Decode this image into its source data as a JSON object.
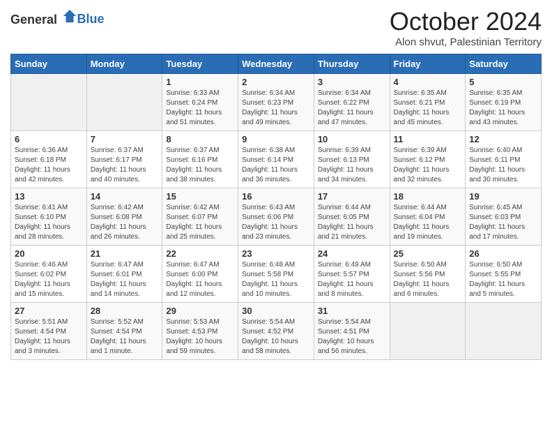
{
  "header": {
    "logo_general": "General",
    "logo_blue": "Blue",
    "month": "October 2024",
    "location": "Alon shvut, Palestinian Territory"
  },
  "days_of_week": [
    "Sunday",
    "Monday",
    "Tuesday",
    "Wednesday",
    "Thursday",
    "Friday",
    "Saturday"
  ],
  "weeks": [
    [
      {
        "day": "",
        "info": ""
      },
      {
        "day": "",
        "info": ""
      },
      {
        "day": "1",
        "info": "Sunrise: 6:33 AM\nSunset: 6:24 PM\nDaylight: 11 hours and 51 minutes."
      },
      {
        "day": "2",
        "info": "Sunrise: 6:34 AM\nSunset: 6:23 PM\nDaylight: 11 hours and 49 minutes."
      },
      {
        "day": "3",
        "info": "Sunrise: 6:34 AM\nSunset: 6:22 PM\nDaylight: 11 hours and 47 minutes."
      },
      {
        "day": "4",
        "info": "Sunrise: 6:35 AM\nSunset: 6:21 PM\nDaylight: 11 hours and 45 minutes."
      },
      {
        "day": "5",
        "info": "Sunrise: 6:35 AM\nSunset: 6:19 PM\nDaylight: 11 hours and 43 minutes."
      }
    ],
    [
      {
        "day": "6",
        "info": "Sunrise: 6:36 AM\nSunset: 6:18 PM\nDaylight: 11 hours and 42 minutes."
      },
      {
        "day": "7",
        "info": "Sunrise: 6:37 AM\nSunset: 6:17 PM\nDaylight: 11 hours and 40 minutes."
      },
      {
        "day": "8",
        "info": "Sunrise: 6:37 AM\nSunset: 6:16 PM\nDaylight: 11 hours and 38 minutes."
      },
      {
        "day": "9",
        "info": "Sunrise: 6:38 AM\nSunset: 6:14 PM\nDaylight: 11 hours and 36 minutes."
      },
      {
        "day": "10",
        "info": "Sunrise: 6:39 AM\nSunset: 6:13 PM\nDaylight: 11 hours and 34 minutes."
      },
      {
        "day": "11",
        "info": "Sunrise: 6:39 AM\nSunset: 6:12 PM\nDaylight: 11 hours and 32 minutes."
      },
      {
        "day": "12",
        "info": "Sunrise: 6:40 AM\nSunset: 6:11 PM\nDaylight: 11 hours and 30 minutes."
      }
    ],
    [
      {
        "day": "13",
        "info": "Sunrise: 6:41 AM\nSunset: 6:10 PM\nDaylight: 11 hours and 28 minutes."
      },
      {
        "day": "14",
        "info": "Sunrise: 6:42 AM\nSunset: 6:08 PM\nDaylight: 11 hours and 26 minutes."
      },
      {
        "day": "15",
        "info": "Sunrise: 6:42 AM\nSunset: 6:07 PM\nDaylight: 11 hours and 25 minutes."
      },
      {
        "day": "16",
        "info": "Sunrise: 6:43 AM\nSunset: 6:06 PM\nDaylight: 11 hours and 23 minutes."
      },
      {
        "day": "17",
        "info": "Sunrise: 6:44 AM\nSunset: 6:05 PM\nDaylight: 11 hours and 21 minutes."
      },
      {
        "day": "18",
        "info": "Sunrise: 6:44 AM\nSunset: 6:04 PM\nDaylight: 11 hours and 19 minutes."
      },
      {
        "day": "19",
        "info": "Sunrise: 6:45 AM\nSunset: 6:03 PM\nDaylight: 11 hours and 17 minutes."
      }
    ],
    [
      {
        "day": "20",
        "info": "Sunrise: 6:46 AM\nSunset: 6:02 PM\nDaylight: 11 hours and 15 minutes."
      },
      {
        "day": "21",
        "info": "Sunrise: 6:47 AM\nSunset: 6:01 PM\nDaylight: 11 hours and 14 minutes."
      },
      {
        "day": "22",
        "info": "Sunrise: 6:47 AM\nSunset: 6:00 PM\nDaylight: 11 hours and 12 minutes."
      },
      {
        "day": "23",
        "info": "Sunrise: 6:48 AM\nSunset: 5:58 PM\nDaylight: 11 hours and 10 minutes."
      },
      {
        "day": "24",
        "info": "Sunrise: 6:49 AM\nSunset: 5:57 PM\nDaylight: 11 hours and 8 minutes."
      },
      {
        "day": "25",
        "info": "Sunrise: 6:50 AM\nSunset: 5:56 PM\nDaylight: 11 hours and 6 minutes."
      },
      {
        "day": "26",
        "info": "Sunrise: 6:50 AM\nSunset: 5:55 PM\nDaylight: 11 hours and 5 minutes."
      }
    ],
    [
      {
        "day": "27",
        "info": "Sunrise: 5:51 AM\nSunset: 4:54 PM\nDaylight: 11 hours and 3 minutes."
      },
      {
        "day": "28",
        "info": "Sunrise: 5:52 AM\nSunset: 4:54 PM\nDaylight: 11 hours and 1 minute."
      },
      {
        "day": "29",
        "info": "Sunrise: 5:53 AM\nSunset: 4:53 PM\nDaylight: 10 hours and 59 minutes."
      },
      {
        "day": "30",
        "info": "Sunrise: 5:54 AM\nSunset: 4:52 PM\nDaylight: 10 hours and 58 minutes."
      },
      {
        "day": "31",
        "info": "Sunrise: 5:54 AM\nSunset: 4:51 PM\nDaylight: 10 hours and 56 minutes."
      },
      {
        "day": "",
        "info": ""
      },
      {
        "day": "",
        "info": ""
      }
    ]
  ]
}
